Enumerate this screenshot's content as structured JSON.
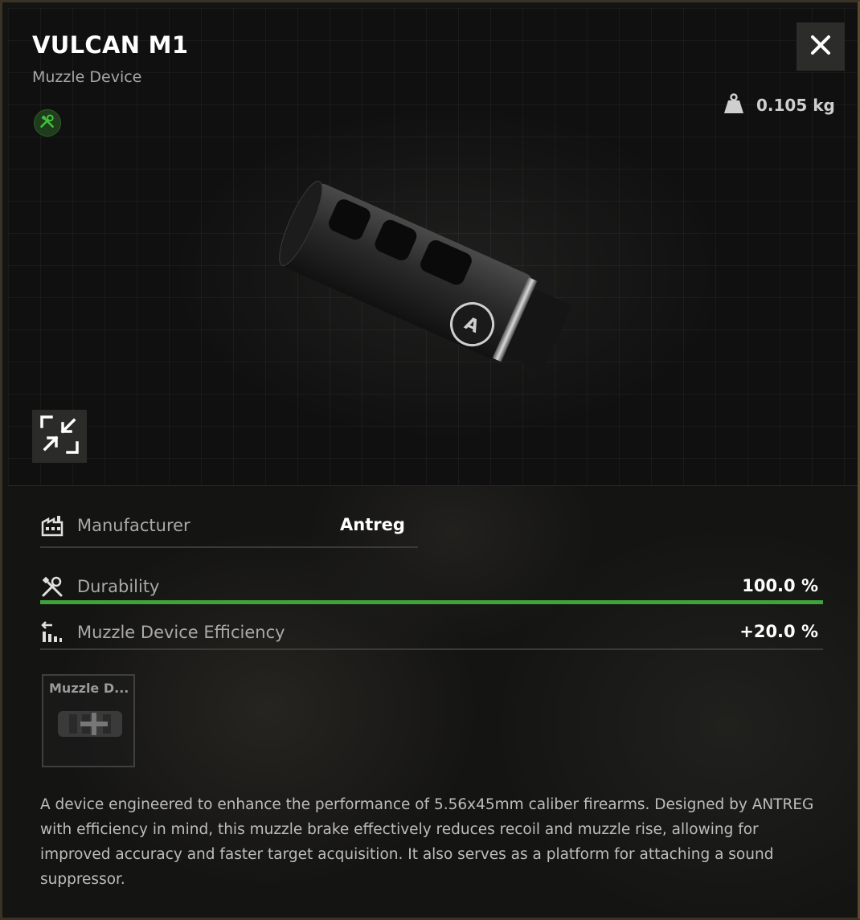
{
  "item": {
    "title": "VULCAN M1",
    "category": "Muzzle Device",
    "weight": "0.105 kg",
    "icons": {
      "repair": "wrench-screwdriver-icon",
      "close": "close-icon",
      "weight": "weight-icon",
      "collapse": "collapse-arrows-icon"
    }
  },
  "stats": {
    "manufacturer": {
      "label": "Manufacturer",
      "value": "Antreg",
      "icon": "factory-icon"
    },
    "durability": {
      "label": "Durability",
      "value": "100.0 %",
      "fraction": 1.0,
      "icon": "wrench-screwdriver-icon"
    },
    "efficiency": {
      "label": "Muzzle Device Efficiency",
      "value": "+20.0 %",
      "icon": "arrows-bars-icon"
    }
  },
  "slot": {
    "label": "Muzzle D..."
  },
  "description": "A device engineered to enhance the performance of 5.56x45mm caliber firearms. Designed by ANTREG with efficiency in mind, this muzzle brake effectively reduces recoil and muzzle rise, allowing for improved accuracy and faster target acquisition. It also serves as a platform for attaching a sound suppressor.",
  "colors": {
    "durability_bar": "#3fa23a",
    "repair_badge": "#3fc23a"
  }
}
